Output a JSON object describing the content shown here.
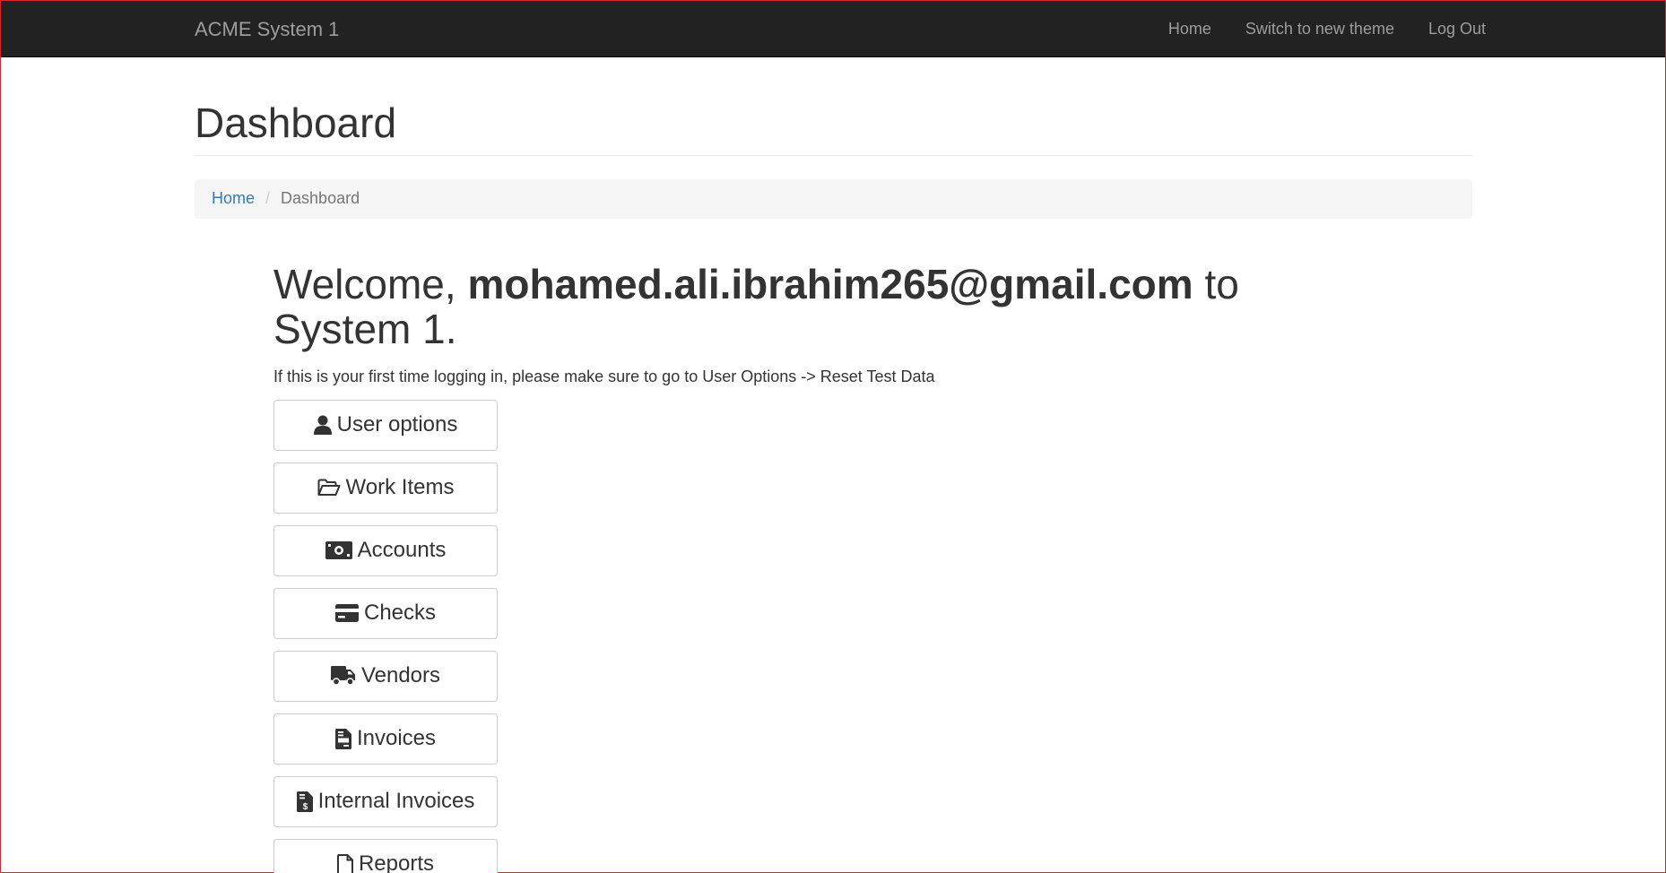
{
  "navbar": {
    "brand": "ACME System 1",
    "links": [
      "Home",
      "Switch to new theme",
      "Log Out"
    ]
  },
  "page": {
    "title": "Dashboard"
  },
  "breadcrumb": {
    "home": "Home",
    "separator": "/",
    "current": "Dashboard"
  },
  "welcome": {
    "prefix": "Welcome, ",
    "user": "mohamed.ali.ibrahim265@gmail.com",
    "suffix": " to System 1.",
    "notice": "If this is your first time logging in, please make sure to go to User Options -> Reset Test Data"
  },
  "buttons": [
    {
      "label": "User options",
      "icon": "user-icon"
    },
    {
      "label": "Work Items",
      "icon": "folder-open-icon"
    },
    {
      "label": "Accounts",
      "icon": "money-bill-icon"
    },
    {
      "label": "Checks",
      "icon": "credit-card-icon"
    },
    {
      "label": "Vendors",
      "icon": "truck-icon"
    },
    {
      "label": "Invoices",
      "icon": "file-invoice-icon"
    },
    {
      "label": "Internal Invoices",
      "icon": "file-invoice-dollar-icon"
    },
    {
      "label": "Reports",
      "icon": "file-icon"
    }
  ],
  "colors": {
    "navbar_bg": "#222222",
    "link": "#337ab7",
    "frame": "#d9262c"
  }
}
